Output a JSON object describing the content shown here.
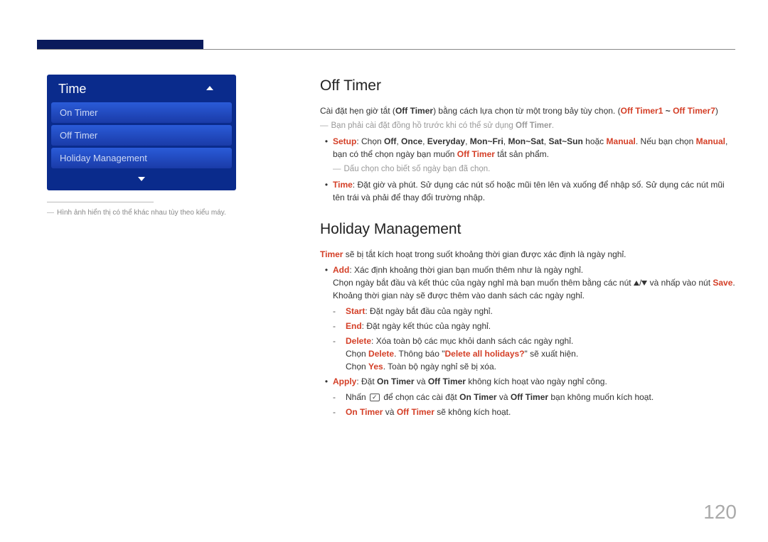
{
  "pageNumber": "120",
  "sidebar": {
    "menuTitle": "Time",
    "items": [
      "On Timer",
      "Off Timer",
      "Holiday Management"
    ],
    "caption": "Hình ảnh hiển thị có thể khác nhau tùy theo kiểu máy."
  },
  "section1": {
    "title": "Off Timer",
    "intro_a": "Cài đặt hẹn giờ tắt (",
    "intro_b": "Off Timer",
    "intro_c": ") bằng cách lựa chọn từ một trong bảy tùy chọn. (",
    "intro_d": "Off Timer1",
    "intro_e": " ~ ",
    "intro_f": "Off Timer7",
    "intro_g": ")",
    "note_a": "Bạn phải cài đặt đồng hồ trước khi có thể sử dụng ",
    "note_b": "Off Timer",
    "note_c": ".",
    "setup": {
      "label": "Setup",
      "a": ": Chọn ",
      "off": "Off",
      "c1": ", ",
      "once": "Once",
      "c2": ", ",
      "everyday": "Everyday",
      "c3": ", ",
      "monfri": "Mon~Fri",
      "c4": ", ",
      "monsat": "Mon~Sat",
      "c5": ", ",
      "satsun": "Sat~Sun",
      "or": " hoặc ",
      "manual": "Manual",
      "tail_a": ". Nếu bạn chọn ",
      "manual2": "Manual",
      "tail_b": ", bạn có thể chọn ngày bạn muốn ",
      "offtimer": "Off Timer",
      "tail_c": " tắt sản phẩm."
    },
    "subnote": "Dấu chọn cho biết số ngày bạn đã chọn.",
    "time": {
      "label": "Time",
      "text": ": Đặt giờ và phút. Sử dụng các nút số hoặc mũi tên lên và xuống để nhập số. Sử dụng các nút mũi tên trái và phải để thay đổi trường nhập."
    }
  },
  "section2": {
    "title": "Holiday Management",
    "intro_a": "Timer",
    "intro_b": " sẽ bị tắt kích hoạt trong suốt khoảng thời gian được xác định là ngày nghỉ.",
    "add": {
      "label": "Add",
      "a": ": Xác định khoảng thời gian bạn muốn thêm như là ngày nghỉ.",
      "line2_a": "Chọn ngày bắt đầu và kết thúc của ngày nghỉ mà bạn muốn thêm bằng các nút ",
      "line2_b": " và nhấp vào nút ",
      "save": "Save",
      "line2_c": ".",
      "line3": "Khoảng thời gian này sẽ được thêm vào danh sách các ngày nghỉ.",
      "start_label": "Start",
      "start_text": ": Đặt ngày bắt đầu của ngày nghỉ.",
      "end_label": "End",
      "end_text": ": Đặt ngày kết thúc của ngày nghỉ.",
      "delete_label": "Delete",
      "delete_text": ": Xóa toàn bộ các mục khỏi danh sách các ngày nghỉ.",
      "del2_a": "Chọn ",
      "del2_b": "Delete",
      "del2_c": ". Thông báo \"",
      "del2_d": "Delete all holidays?",
      "del2_e": "\" sẽ xuất hiện.",
      "del3_a": "Chọn ",
      "del3_b": "Yes",
      "del3_c": ". Toàn bộ ngày nghỉ sẽ bị xóa."
    },
    "apply": {
      "label": "Apply",
      "a": ": Đặt ",
      "on": "On Timer",
      "b": " và ",
      "off": "Off Timer",
      "c": " không kích hoạt vào ngày nghỉ công.",
      "sub1_a": "Nhấn ",
      "sub1_b": " để chọn các cài đặt ",
      "sub1_on": "On Timer",
      "sub1_c": " và ",
      "sub1_off": "Off Timer",
      "sub1_d": " bạn không muốn kích hoạt.",
      "sub2_on": "On Timer",
      "sub2_a": " và ",
      "sub2_off": "Off Timer",
      "sub2_b": " sẽ không kích hoạt."
    }
  }
}
